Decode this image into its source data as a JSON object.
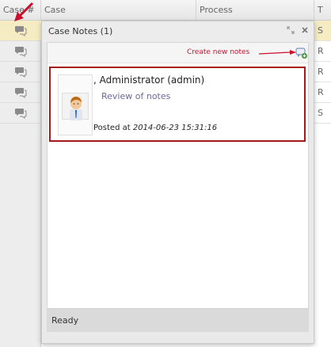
{
  "grid": {
    "columns": [
      "Case #",
      "Case",
      "Process",
      "T"
    ],
    "right_col_cells": [
      "S",
      "R",
      "R",
      "R",
      "S"
    ]
  },
  "dialog": {
    "title": "Case Notes (1)",
    "restore_icon": "restore-icon",
    "close_icon": "close-icon",
    "create_hint": "Create new  notes",
    "status": "Ready"
  },
  "note": {
    "author": ", Administrator (admin)",
    "text": "Review of notes",
    "posted_prefix": "Posted at ",
    "posted_date": "2014-06-23 15:31:16"
  },
  "colors": {
    "highlight": "#a31a1a",
    "hint_text": "#c8102e",
    "selected_row": "#f6ecc3"
  }
}
